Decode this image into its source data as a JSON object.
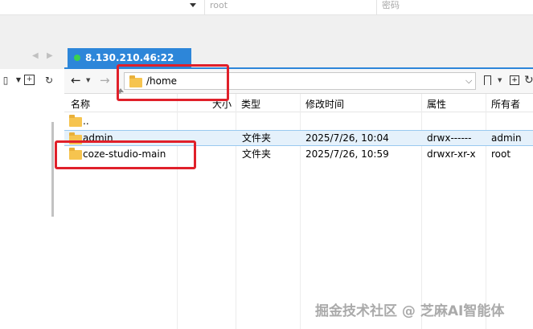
{
  "connection": {
    "user_value": "root",
    "password_placeholder": "密码"
  },
  "tab": {
    "label": "8.130.210.46:22",
    "status_color": "#3bd14f"
  },
  "nav": {
    "back_icon": "arrow-left-icon",
    "forward_icon": "arrow-right-icon",
    "path": "/home"
  },
  "columns": {
    "name": "名称",
    "size": "大小",
    "type": "类型",
    "modified": "修改时间",
    "attrs": "属性",
    "owner": "所有者"
  },
  "rows": [
    {
      "name": "..",
      "type": "",
      "modified": "",
      "attrs": "",
      "owner": ""
    },
    {
      "name": "admin",
      "type": "文件夹",
      "modified": "2025/7/26, 10:04",
      "attrs": "drwx------",
      "owner": "admin"
    },
    {
      "name": "coze-studio-main",
      "type": "文件夹",
      "modified": "2025/7/26, 10:59",
      "attrs": "drwxr-xr-x",
      "owner": "root"
    }
  ],
  "watermark": "掘金技术社区 @ 芝麻AI智能体",
  "accent_color": "#2d86d9",
  "annotation_color": "#e0202a"
}
